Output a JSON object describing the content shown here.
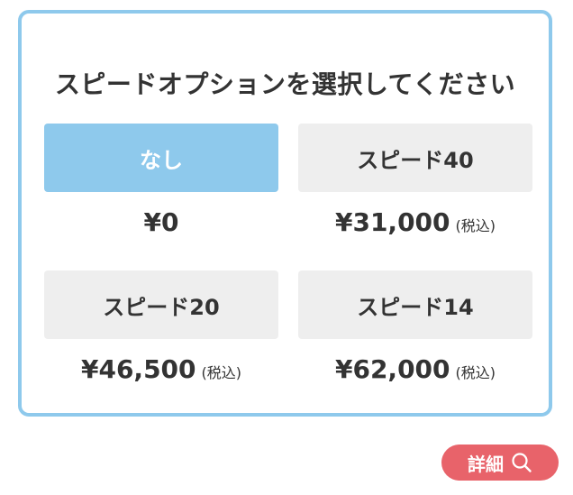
{
  "panel": {
    "title": "スピードオプションを選択してください"
  },
  "options": [
    {
      "label": "なし",
      "price": "¥0",
      "tax_note": "",
      "selected": true
    },
    {
      "label": "スピード40",
      "price": "¥31,000",
      "tax_note": "(税込)",
      "selected": false
    },
    {
      "label": "スピード20",
      "price": "¥46,500",
      "tax_note": "(税込)",
      "selected": false
    },
    {
      "label": "スピード14",
      "price": "¥62,000",
      "tax_note": "(税込)",
      "selected": false
    }
  ],
  "detail_button": {
    "label": "詳細",
    "icon": "search-icon"
  },
  "colors": {
    "accent": "#8ec9ec",
    "button_bg": "#eeeeee",
    "detail_bg": "#e8636a",
    "text": "#333333"
  }
}
